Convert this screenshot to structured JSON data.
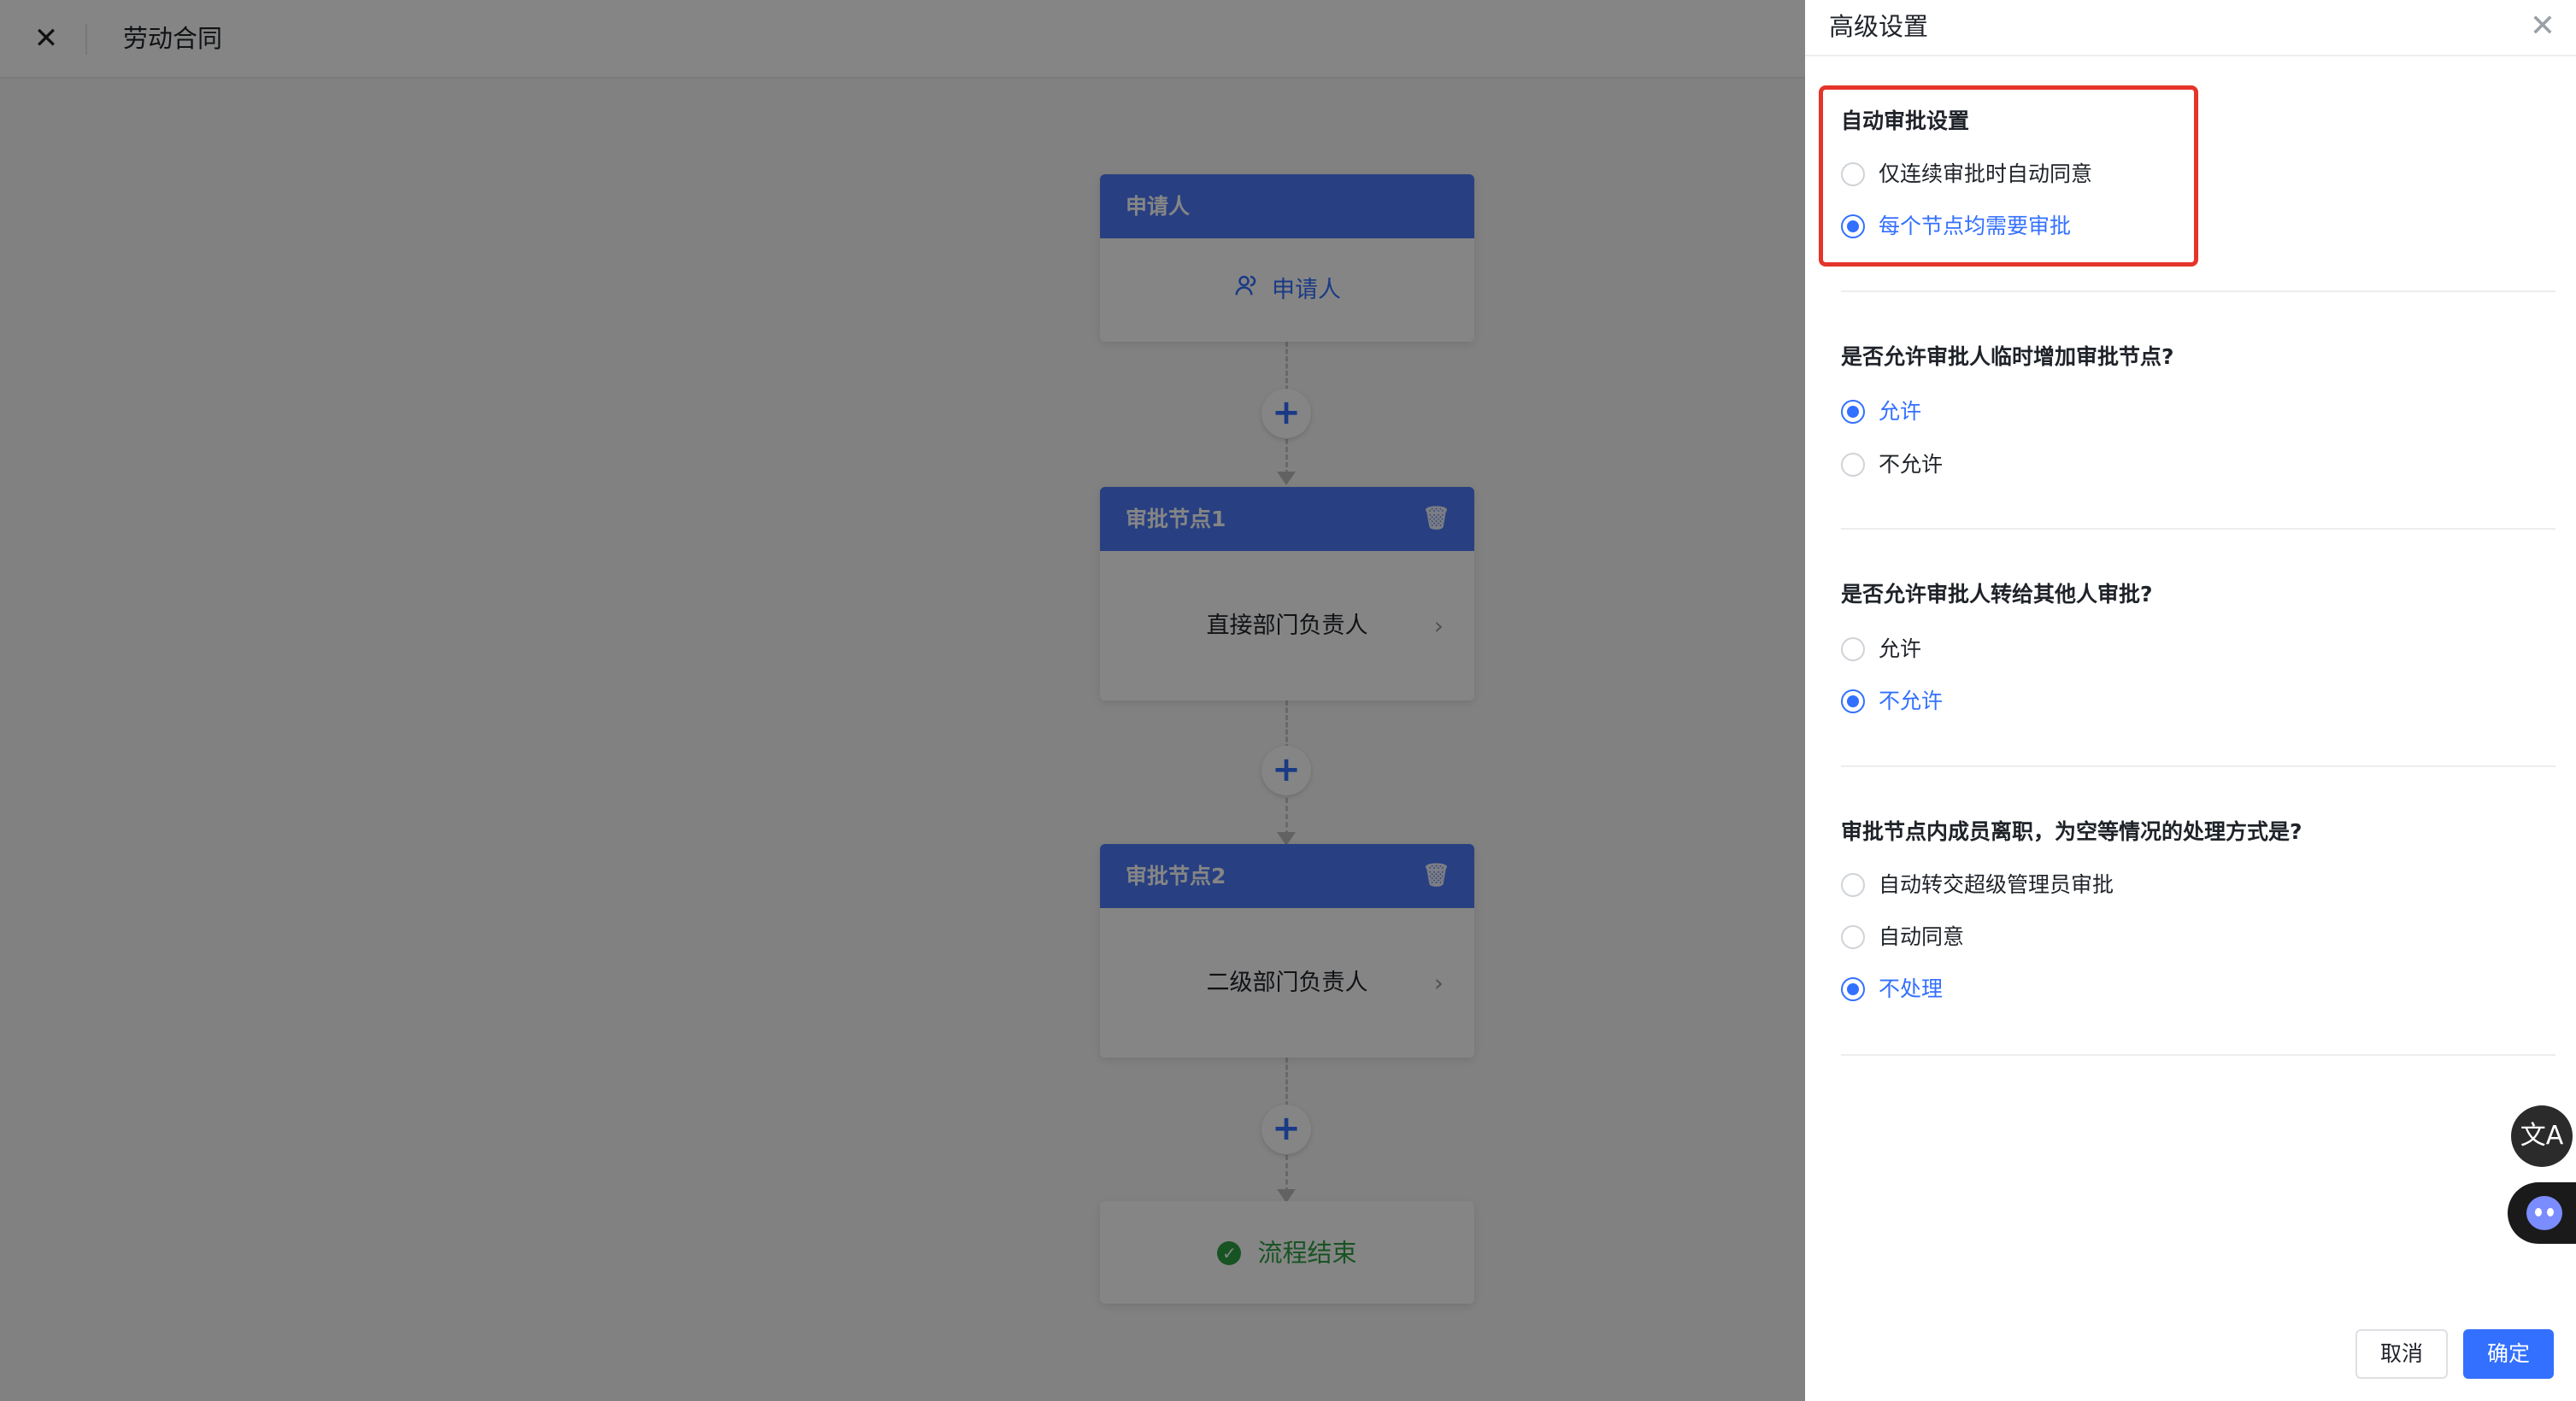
{
  "app": {
    "title": "劳动合同",
    "close_glyph": "✕"
  },
  "flow": {
    "applicant": {
      "header": "申请人",
      "body": "申请人",
      "icon": "user-icon"
    },
    "nodes": [
      {
        "header": "审批节点1",
        "body": "直接部门负责人"
      },
      {
        "header": "审批节点2",
        "body": "二级部门负责人"
      }
    ],
    "add_glyph": "+",
    "end": {
      "label": "流程结束",
      "icon": "check-circle-icon"
    }
  },
  "drawer": {
    "title": "高级设置",
    "close_glyph": "✕",
    "sections": [
      {
        "title": "自动审批设置",
        "options": [
          {
            "label": "仅连续审批时自动同意",
            "checked": false
          },
          {
            "label": "每个节点均需要审批",
            "checked": true
          }
        ]
      },
      {
        "title": "是否允许审批人临时增加审批节点?",
        "options": [
          {
            "label": "允许",
            "checked": true
          },
          {
            "label": "不允许",
            "checked": false
          }
        ]
      },
      {
        "title": "是否允许审批人转给其他人审批?",
        "options": [
          {
            "label": "允许",
            "checked": false
          },
          {
            "label": "不允许",
            "checked": true
          }
        ]
      },
      {
        "title": "审批节点内成员离职，为空等情况的处理方式是?",
        "options": [
          {
            "label": "自动转交超级管理员审批",
            "checked": false
          },
          {
            "label": "自动同意",
            "checked": false
          },
          {
            "label": "不处理",
            "checked": true
          }
        ]
      }
    ],
    "cancel_label": "取消",
    "ok_label": "确定"
  },
  "floating": {
    "translate_glyph": "文A",
    "translate_icon": "translate-icon",
    "assistant_icon": "assistant-bot-icon"
  },
  "colors": {
    "accent": "#3370ff",
    "card_header": "#4e7bf7",
    "success": "#2ea043",
    "highlight": "#e5342a"
  }
}
